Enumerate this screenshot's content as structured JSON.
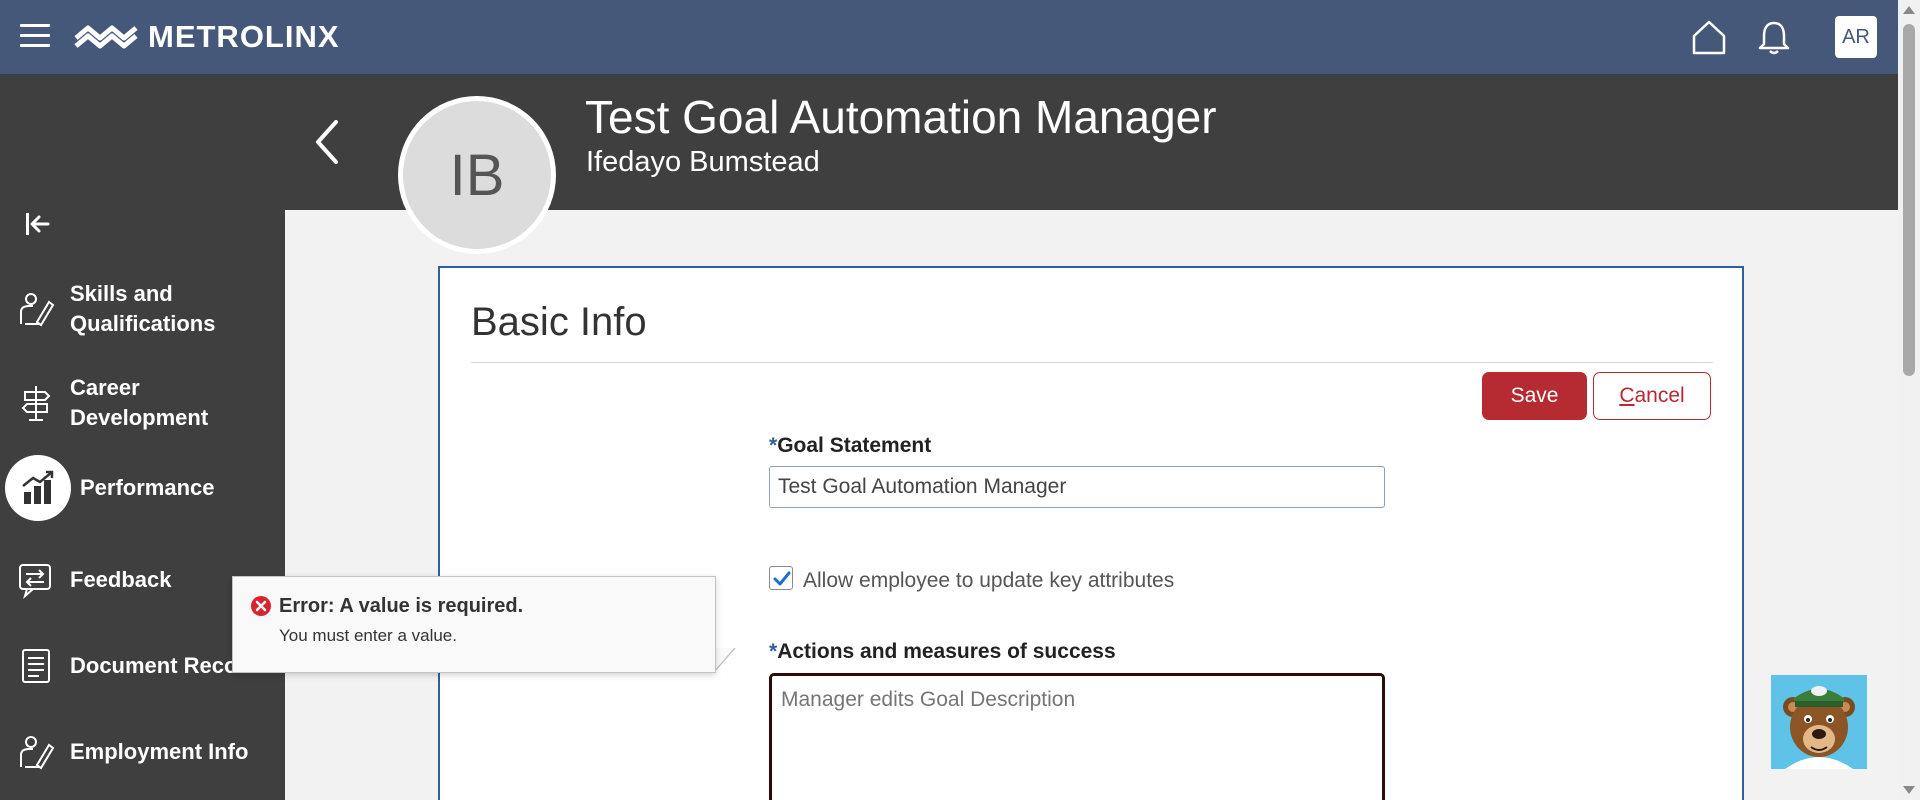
{
  "topbar": {
    "brand": "METROLINX",
    "user_initials": "AR",
    "icons": [
      "menu-icon",
      "metrolinx-logo",
      "home-icon",
      "bell-icon"
    ]
  },
  "sidebar": {
    "collapse_icon": "collapse-left-icon",
    "items": [
      {
        "label_line1": "Skills and",
        "label_line2": "Qualifications",
        "icon": "skills-icon"
      },
      {
        "label_line1": "Career",
        "label_line2": "Development",
        "icon": "signpost-icon"
      },
      {
        "label": "Performance",
        "icon": "performance-chart-icon"
      },
      {
        "label": "Feedback",
        "icon": "feedback-icon"
      },
      {
        "label": "Document Records",
        "icon": "document-icon"
      },
      {
        "label": "Employment Info",
        "icon": "employment-icon"
      }
    ]
  },
  "header": {
    "avatar_initials": "IB",
    "title": "Test Goal Automation Manager",
    "subtitle": "Ifedayo Bumstead"
  },
  "form": {
    "section_title": "Basic Info",
    "save_label": "Save",
    "cancel_first": "C",
    "cancel_rest": "ancel",
    "required_mark": "*",
    "goal_statement_label": "Goal Statement",
    "goal_statement_value": "Test Goal Automation Manager",
    "allow_update_label": "Allow employee to update key attributes",
    "allow_update_checked": true,
    "actions_label": "Actions and measures of success",
    "actions_placeholder": "Manager edits Goal Description"
  },
  "error": {
    "title": "Error: A value is required.",
    "message": "You must enter a value."
  },
  "colors": {
    "topbar": "#46587a",
    "sidebar": "#3f3f3f",
    "accent_red": "#b62a31",
    "required_blue": "#2f5f9d"
  }
}
